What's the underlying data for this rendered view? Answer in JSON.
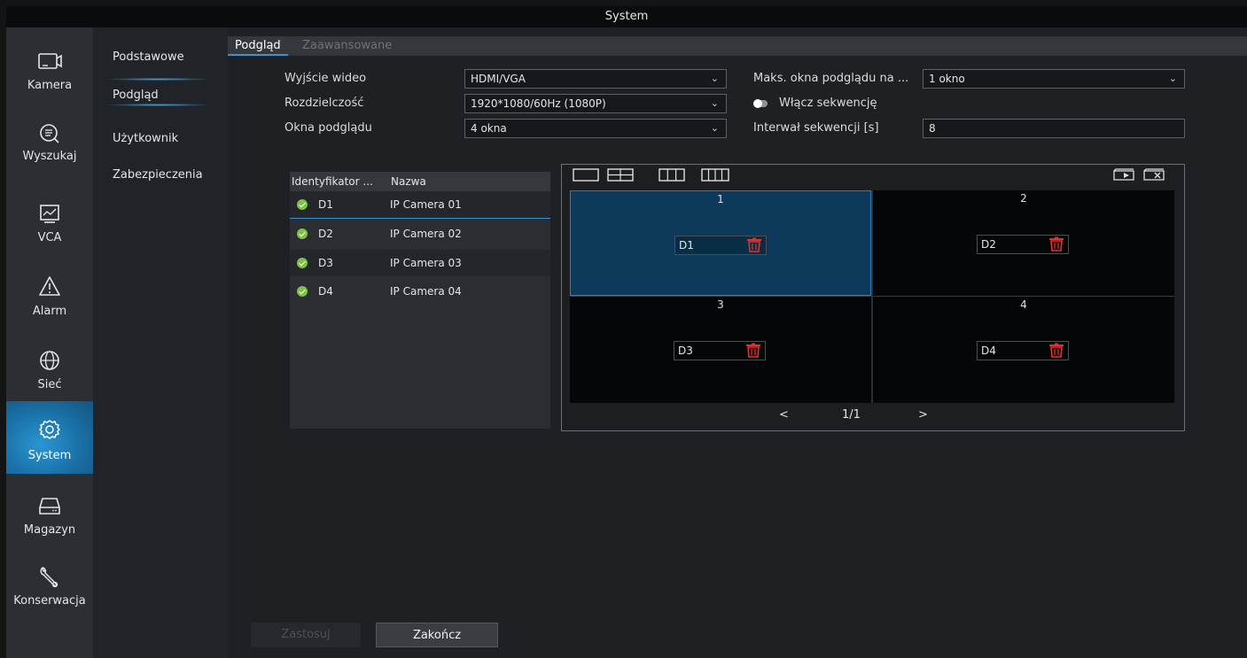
{
  "window": {
    "title": "System"
  },
  "nav": {
    "items": [
      {
        "label": "Kamera",
        "icon": "camera-icon"
      },
      {
        "label": "Wyszukaj",
        "icon": "search-icon"
      },
      {
        "label": "VCA",
        "icon": "vca-icon"
      },
      {
        "label": "Alarm",
        "icon": "alarm-icon"
      },
      {
        "label": "Sieć",
        "icon": "network-icon"
      },
      {
        "label": "System",
        "icon": "gear-icon",
        "active": true
      },
      {
        "label": "Magazyn",
        "icon": "storage-icon"
      },
      {
        "label": "Konserwacja",
        "icon": "wrench-icon"
      }
    ]
  },
  "submenu": {
    "items": [
      {
        "label": "Podstawowe"
      },
      {
        "label": "Podgląd",
        "active": true
      },
      {
        "label": "Użytkownik"
      },
      {
        "label": "Zabezpieczenia"
      }
    ]
  },
  "tabs": [
    {
      "label": "Podgląd",
      "active": true
    },
    {
      "label": "Zaawansowane"
    }
  ],
  "form": {
    "video_output": {
      "label": "Wyjście wideo",
      "value": "HDMI/VGA"
    },
    "resolution": {
      "label": "Rozdzielczość",
      "value": "1920*1080/60Hz (1080P)"
    },
    "preview_windows": {
      "label": "Okna podglądu",
      "value": "4 okna"
    },
    "max_windows": {
      "label": "Maks. okna podglądu na ...",
      "value": "1 okno"
    },
    "sequence": {
      "label": "Włącz sekwencję",
      "enabled": false
    },
    "sequence_interval": {
      "label": "Interwał sekwencji [s]",
      "value": "8"
    }
  },
  "camlist": {
    "headers": {
      "id": "Identyfikator ...",
      "name": "Nazwa"
    },
    "rows": [
      {
        "id": "D1",
        "name": "IP Camera 01",
        "selected": true
      },
      {
        "id": "D2",
        "name": "IP Camera 02"
      },
      {
        "id": "D3",
        "name": "IP Camera 03"
      },
      {
        "id": "D4",
        "name": "IP Camera 04"
      }
    ]
  },
  "preview": {
    "cells": [
      {
        "num": "1",
        "cam": "D1",
        "selected": true
      },
      {
        "num": "2",
        "cam": "D2"
      },
      {
        "num": "3",
        "cam": "D3"
      },
      {
        "num": "4",
        "cam": "D4"
      }
    ],
    "pager": {
      "prev": "<",
      "page": "1/1",
      "next": ">"
    }
  },
  "buttons": {
    "apply": "Zastosuj",
    "finish": "Zakończ"
  },
  "colors": {
    "accent": "#3d8fd6",
    "active_nav": "#1a6fa6",
    "check": "#7fc143",
    "trash": "#e5312d"
  }
}
